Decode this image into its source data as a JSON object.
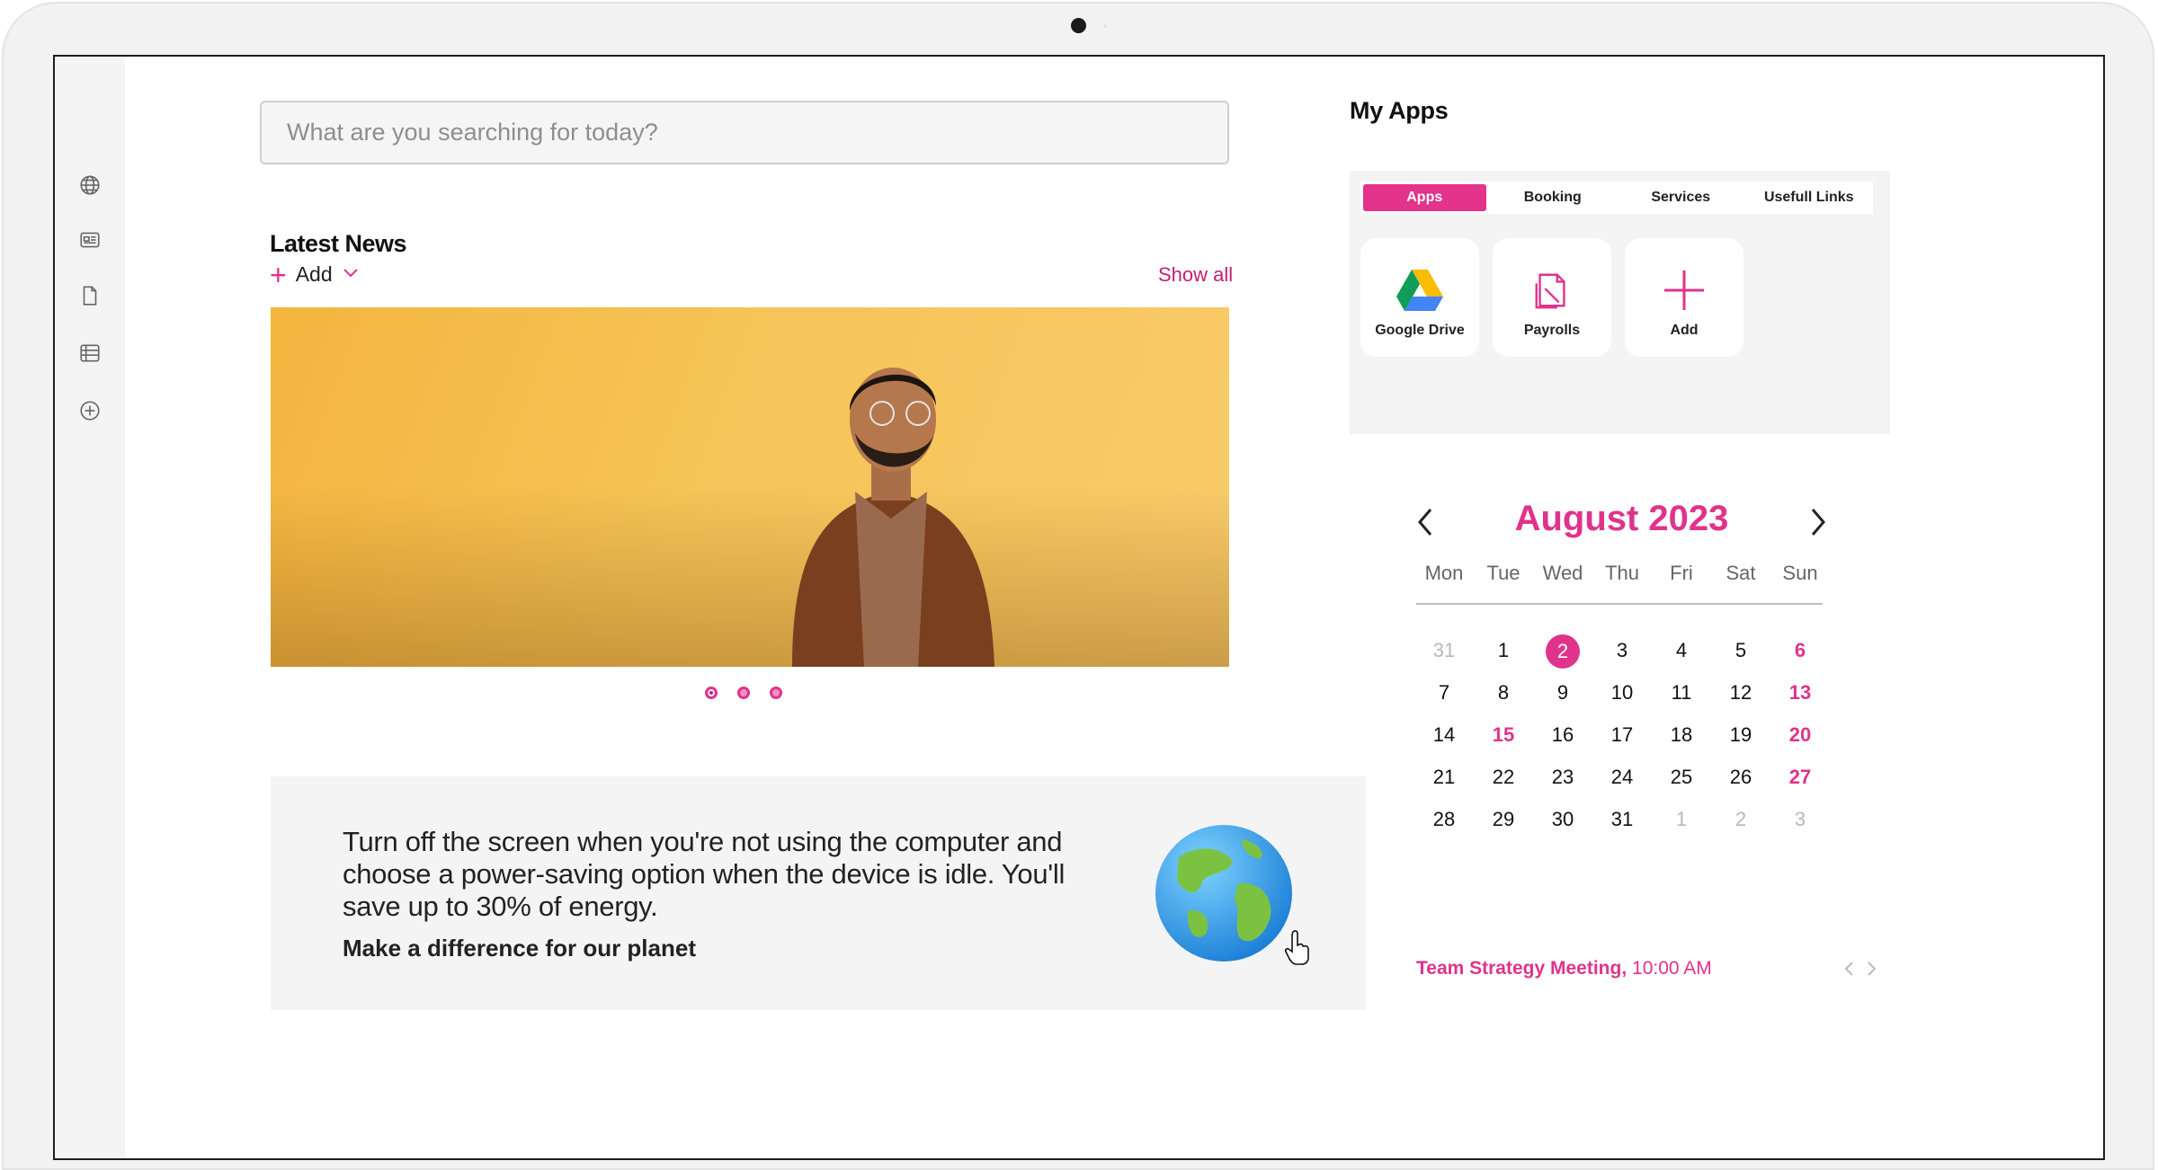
{
  "search": {
    "placeholder": "What are you searching for today?"
  },
  "news": {
    "title": "Latest News",
    "add_label": "Add",
    "show_all": "Show all",
    "slides": 3,
    "active_slide": 1
  },
  "eco": {
    "text": "Turn off the screen when you're not using the computer and choose a power-saving option when the device is idle. You'll save up to 30% of energy.",
    "cta": "Make a difference for our planet"
  },
  "apps": {
    "title": "My Apps",
    "tabs": [
      {
        "label": "Apps",
        "active": true
      },
      {
        "label": "Booking",
        "active": false
      },
      {
        "label": "Services",
        "active": false
      },
      {
        "label": "Usefull Links",
        "active": false
      }
    ],
    "tiles": [
      {
        "label": "Google Drive",
        "icon": "google-drive-icon"
      },
      {
        "label": "Payrolls",
        "icon": "payrolls-icon"
      },
      {
        "label": "Add",
        "icon": "plus-icon"
      }
    ]
  },
  "calendar": {
    "title": "August 2023",
    "weekdays": [
      "Mon",
      "Tue",
      "Wed",
      "Thu",
      "Fri",
      "Sat",
      "Sun"
    ],
    "weeks": [
      [
        {
          "d": "31",
          "muted": true
        },
        {
          "d": "1"
        },
        {
          "d": "2",
          "today": true
        },
        {
          "d": "3"
        },
        {
          "d": "4"
        },
        {
          "d": "5"
        },
        {
          "d": "6",
          "sun": true
        }
      ],
      [
        {
          "d": "7"
        },
        {
          "d": "8"
        },
        {
          "d": "9"
        },
        {
          "d": "10"
        },
        {
          "d": "11"
        },
        {
          "d": "12"
        },
        {
          "d": "13",
          "sun": true
        }
      ],
      [
        {
          "d": "14"
        },
        {
          "d": "15",
          "hol": true
        },
        {
          "d": "16"
        },
        {
          "d": "17"
        },
        {
          "d": "18"
        },
        {
          "d": "19"
        },
        {
          "d": "20",
          "sun": true
        }
      ],
      [
        {
          "d": "21"
        },
        {
          "d": "22"
        },
        {
          "d": "23"
        },
        {
          "d": "24"
        },
        {
          "d": "25"
        },
        {
          "d": "26"
        },
        {
          "d": "27",
          "sun": true
        }
      ],
      [
        {
          "d": "28"
        },
        {
          "d": "29"
        },
        {
          "d": "30"
        },
        {
          "d": "31"
        },
        {
          "d": "1",
          "muted": true
        },
        {
          "d": "2",
          "muted": true
        },
        {
          "d": "3",
          "muted": true
        }
      ]
    ],
    "event": {
      "name": "Team Strategy Meeting,",
      "time": "10:00 AM"
    }
  },
  "colors": {
    "accent": "#e0338b",
    "panel": "#f4f4f4",
    "hero": "#f6c457"
  }
}
